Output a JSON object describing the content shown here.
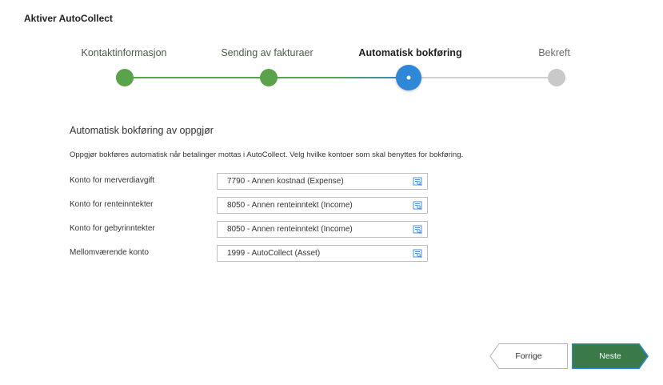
{
  "page": {
    "title": "Aktiver AutoCollect"
  },
  "steps": [
    {
      "label": "Kontaktinformasjon",
      "state": "done"
    },
    {
      "label": "Sending av fakturaer",
      "state": "done"
    },
    {
      "label": "Automatisk bokføring",
      "state": "active"
    },
    {
      "label": "Bekreft",
      "state": "pending"
    }
  ],
  "section": {
    "title": "Automatisk bokføring av oppgjør",
    "description": "Oppgjør bokføres automatisk når betalinger mottas i AutoCollect. Velg hvilke kontoer som skal benyttes for bokføring."
  },
  "form": {
    "fields": [
      {
        "label": "Konto for merverdiavgift",
        "value": "7790 - Annen kostnad (Expense)"
      },
      {
        "label": "Konto for renteinntekter",
        "value": "8050 - Annen renteinntekt (Income)"
      },
      {
        "label": "Konto for gebyrinntekter",
        "value": "8050 - Annen renteinntekt (Income)"
      },
      {
        "label": "Mellomværende konto",
        "value": "1999 - AutoCollect (Asset)"
      }
    ]
  },
  "buttons": {
    "previous": "Forrige",
    "next": "Neste"
  },
  "colors": {
    "done": "#5aa34a",
    "active": "#2f87d8",
    "pending": "#c9c9c9",
    "primary_button": "#3a7a48",
    "lookup_icon": "#4a90d9"
  }
}
